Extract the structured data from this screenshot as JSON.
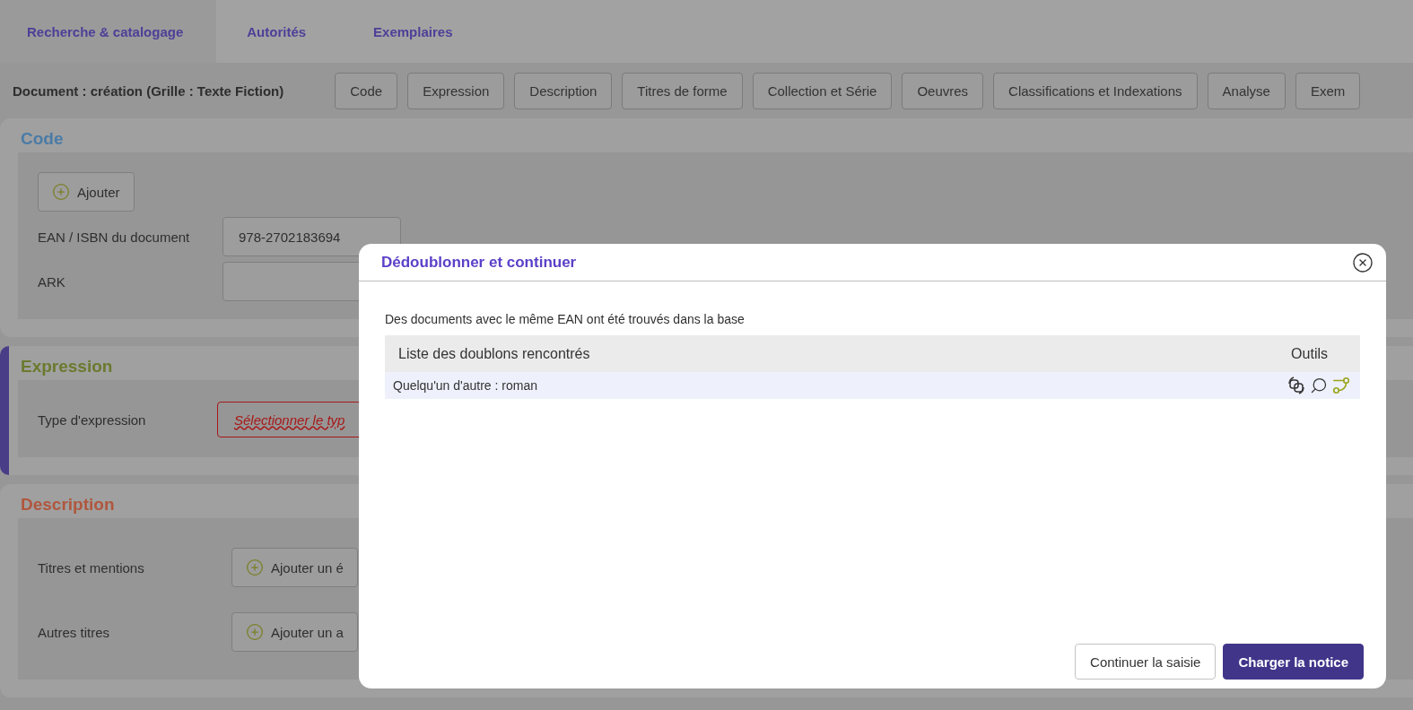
{
  "tabs": [
    {
      "label": "Recherche & catalogage",
      "selected": true
    },
    {
      "label": "Autorités",
      "selected": false
    },
    {
      "label": "Exemplaires",
      "selected": false
    }
  ],
  "document_title": "Document : création (Grille : Texte Fiction)",
  "section_buttons": [
    "Code",
    "Expression",
    "Description",
    "Titres de forme",
    "Collection et Série",
    "Oeuvres",
    "Classifications et Indexations",
    "Analyse",
    "Exem"
  ],
  "sections": [
    {
      "title": "Code",
      "color": "#4a7ba6",
      "active": false,
      "add_button": "Ajouter",
      "rows": [
        {
          "kind": "input",
          "label": "EAN / ISBN du document",
          "value": "978-2702183694"
        },
        {
          "kind": "input",
          "label": "ARK"
        }
      ]
    },
    {
      "title": "Expression",
      "color": "#6b7a2e",
      "active": true,
      "rows": [
        {
          "kind": "select",
          "label": "Type d'expression",
          "placeholder": "Sélectionner le typ",
          "invalid": true
        }
      ]
    },
    {
      "title": "Description",
      "color": "#b0573e",
      "active": false,
      "rows": [
        {
          "kind": "add",
          "label": "Titres et mentions",
          "button": "Ajouter un é"
        },
        {
          "kind": "add",
          "label": "Autres titres",
          "button": "Ajouter un a"
        }
      ]
    }
  ],
  "dialog": {
    "title": "Dédoublonner et continuer",
    "message": "Des documents avec le même EAN ont été trouvés dans la base",
    "table": {
      "columns": [
        "Liste des doublons rencontrés",
        "Outils"
      ],
      "rows": [
        {
          "title": "Quelqu'un d'autre : roman",
          "selected": true
        }
      ]
    },
    "buttons": [
      {
        "label": "Continuer la saisie",
        "primary": false
      },
      {
        "label": "Charger la notice",
        "primary": true
      }
    ]
  }
}
